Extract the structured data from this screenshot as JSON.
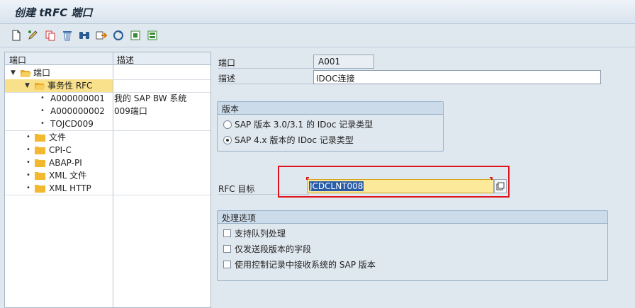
{
  "window": {
    "title": "创建 tRFC 端口"
  },
  "toolbar": {
    "icons": [
      "new-document-icon",
      "edit-icon",
      "copy-icon",
      "delete-icon",
      "find-icon",
      "transport-icon",
      "refresh-icon",
      "print-icon",
      "print-preview-icon"
    ]
  },
  "tree": {
    "headers": {
      "port": "端口",
      "description": "描述"
    },
    "nodes": {
      "root": "端口",
      "trfc": "事务性 RFC",
      "item1": {
        "name": "A000000001",
        "desc": "我的 SAP BW 系统"
      },
      "item2": {
        "name": "A000000002",
        "desc": "009端口"
      },
      "item3": {
        "name": "TOJCD009",
        "desc": ""
      },
      "file": "文件",
      "cpic": "CPI-C",
      "abap": "ABAP-PI",
      "xmlfile": "XML 文件",
      "xmlhttp": "XML HTTP"
    }
  },
  "form": {
    "port_label": "端口",
    "port_value": "A001",
    "desc_label": "描述",
    "desc_value": "IDOC连接",
    "version_group": {
      "title": "版本",
      "option1": "SAP 版本 3.0/3.1 的 IDoc 记录类型",
      "option2": "SAP 4.x 版本的 IDoc 记录类型",
      "selected": 2
    },
    "rfc_label": "RFC 目标",
    "rfc_value": "JCDCLNT008",
    "processing_group": {
      "title": "处理选项",
      "check1": "支持队列处理",
      "check2": "仅发送段版本的字段",
      "check3": "使用控制记录中接收系统的 SAP 版本"
    }
  },
  "colors": {
    "selection": "#f9e08a",
    "highlight_border": "#e0141c",
    "active_field": "#fde99a"
  }
}
